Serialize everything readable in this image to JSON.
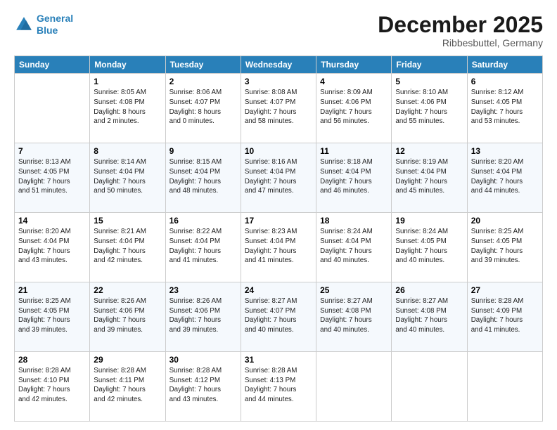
{
  "header": {
    "logo_line1": "General",
    "logo_line2": "Blue",
    "month": "December 2025",
    "location": "Ribbesbuttel, Germany"
  },
  "weekdays": [
    "Sunday",
    "Monday",
    "Tuesday",
    "Wednesday",
    "Thursday",
    "Friday",
    "Saturday"
  ],
  "weeks": [
    [
      {
        "day": "",
        "info": ""
      },
      {
        "day": "1",
        "info": "Sunrise: 8:05 AM\nSunset: 4:08 PM\nDaylight: 8 hours\nand 2 minutes."
      },
      {
        "day": "2",
        "info": "Sunrise: 8:06 AM\nSunset: 4:07 PM\nDaylight: 8 hours\nand 0 minutes."
      },
      {
        "day": "3",
        "info": "Sunrise: 8:08 AM\nSunset: 4:07 PM\nDaylight: 7 hours\nand 58 minutes."
      },
      {
        "day": "4",
        "info": "Sunrise: 8:09 AM\nSunset: 4:06 PM\nDaylight: 7 hours\nand 56 minutes."
      },
      {
        "day": "5",
        "info": "Sunrise: 8:10 AM\nSunset: 4:06 PM\nDaylight: 7 hours\nand 55 minutes."
      },
      {
        "day": "6",
        "info": "Sunrise: 8:12 AM\nSunset: 4:05 PM\nDaylight: 7 hours\nand 53 minutes."
      }
    ],
    [
      {
        "day": "7",
        "info": "Sunrise: 8:13 AM\nSunset: 4:05 PM\nDaylight: 7 hours\nand 51 minutes."
      },
      {
        "day": "8",
        "info": "Sunrise: 8:14 AM\nSunset: 4:04 PM\nDaylight: 7 hours\nand 50 minutes."
      },
      {
        "day": "9",
        "info": "Sunrise: 8:15 AM\nSunset: 4:04 PM\nDaylight: 7 hours\nand 48 minutes."
      },
      {
        "day": "10",
        "info": "Sunrise: 8:16 AM\nSunset: 4:04 PM\nDaylight: 7 hours\nand 47 minutes."
      },
      {
        "day": "11",
        "info": "Sunrise: 8:18 AM\nSunset: 4:04 PM\nDaylight: 7 hours\nand 46 minutes."
      },
      {
        "day": "12",
        "info": "Sunrise: 8:19 AM\nSunset: 4:04 PM\nDaylight: 7 hours\nand 45 minutes."
      },
      {
        "day": "13",
        "info": "Sunrise: 8:20 AM\nSunset: 4:04 PM\nDaylight: 7 hours\nand 44 minutes."
      }
    ],
    [
      {
        "day": "14",
        "info": "Sunrise: 8:20 AM\nSunset: 4:04 PM\nDaylight: 7 hours\nand 43 minutes."
      },
      {
        "day": "15",
        "info": "Sunrise: 8:21 AM\nSunset: 4:04 PM\nDaylight: 7 hours\nand 42 minutes."
      },
      {
        "day": "16",
        "info": "Sunrise: 8:22 AM\nSunset: 4:04 PM\nDaylight: 7 hours\nand 41 minutes."
      },
      {
        "day": "17",
        "info": "Sunrise: 8:23 AM\nSunset: 4:04 PM\nDaylight: 7 hours\nand 41 minutes."
      },
      {
        "day": "18",
        "info": "Sunrise: 8:24 AM\nSunset: 4:04 PM\nDaylight: 7 hours\nand 40 minutes."
      },
      {
        "day": "19",
        "info": "Sunrise: 8:24 AM\nSunset: 4:05 PM\nDaylight: 7 hours\nand 40 minutes."
      },
      {
        "day": "20",
        "info": "Sunrise: 8:25 AM\nSunset: 4:05 PM\nDaylight: 7 hours\nand 39 minutes."
      }
    ],
    [
      {
        "day": "21",
        "info": "Sunrise: 8:25 AM\nSunset: 4:05 PM\nDaylight: 7 hours\nand 39 minutes."
      },
      {
        "day": "22",
        "info": "Sunrise: 8:26 AM\nSunset: 4:06 PM\nDaylight: 7 hours\nand 39 minutes."
      },
      {
        "day": "23",
        "info": "Sunrise: 8:26 AM\nSunset: 4:06 PM\nDaylight: 7 hours\nand 39 minutes."
      },
      {
        "day": "24",
        "info": "Sunrise: 8:27 AM\nSunset: 4:07 PM\nDaylight: 7 hours\nand 40 minutes."
      },
      {
        "day": "25",
        "info": "Sunrise: 8:27 AM\nSunset: 4:08 PM\nDaylight: 7 hours\nand 40 minutes."
      },
      {
        "day": "26",
        "info": "Sunrise: 8:27 AM\nSunset: 4:08 PM\nDaylight: 7 hours\nand 40 minutes."
      },
      {
        "day": "27",
        "info": "Sunrise: 8:28 AM\nSunset: 4:09 PM\nDaylight: 7 hours\nand 41 minutes."
      }
    ],
    [
      {
        "day": "28",
        "info": "Sunrise: 8:28 AM\nSunset: 4:10 PM\nDaylight: 7 hours\nand 42 minutes."
      },
      {
        "day": "29",
        "info": "Sunrise: 8:28 AM\nSunset: 4:11 PM\nDaylight: 7 hours\nand 42 minutes."
      },
      {
        "day": "30",
        "info": "Sunrise: 8:28 AM\nSunset: 4:12 PM\nDaylight: 7 hours\nand 43 minutes."
      },
      {
        "day": "31",
        "info": "Sunrise: 8:28 AM\nSunset: 4:13 PM\nDaylight: 7 hours\nand 44 minutes."
      },
      {
        "day": "",
        "info": ""
      },
      {
        "day": "",
        "info": ""
      },
      {
        "day": "",
        "info": ""
      }
    ]
  ]
}
